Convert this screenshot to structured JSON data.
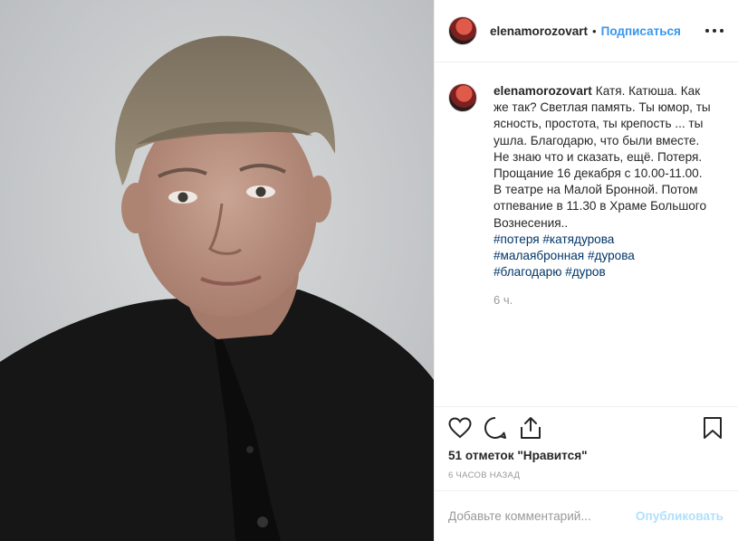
{
  "post": {
    "photo_icon": "portrait-photo",
    "accent_color": "#3897f0",
    "header": {
      "username": "elenamorozovart",
      "separator": "•",
      "follow_label": "Подписаться",
      "more_icon": "more-horizontal-icon"
    },
    "caption": {
      "username": "elenamorozovart",
      "text": "Катя. Катюша. Как же так? Светлая память. Ты юмор, ты ясность, простота, ты крепость ... ты ушла. Благодарю, что были вместе. Не знаю что и сказать, ещё. Потеря. Прощание 16 декабря с 10.00-11.00. В театре на Малой Бронной. Потом отпевание в 11.30 в Храме Большого Вознесения..",
      "hashtags": [
        "#потеря",
        "#катядурова",
        "#малаябронная",
        "#дурова",
        "#благодарю",
        "#дуров"
      ],
      "time": "6 ч."
    },
    "actions": {
      "icons": [
        "heart-icon",
        "comment-icon",
        "share-icon",
        "bookmark-icon"
      ],
      "likes": "51 отметок \"Нравится\"",
      "posted": "6 часов назад"
    },
    "comment_box": {
      "placeholder": "Добавьте комментарий...",
      "publish_label": "Опубликовать"
    }
  }
}
